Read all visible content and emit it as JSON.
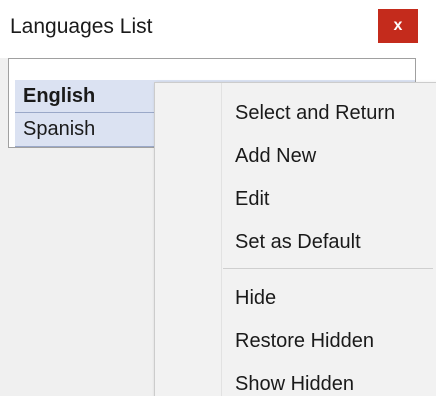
{
  "window": {
    "title": "Languages List",
    "close_label": "x"
  },
  "list": {
    "rows": [
      {
        "label": "English",
        "selected": true
      },
      {
        "label": "Spanish",
        "selected": false
      }
    ]
  },
  "context_menu": {
    "items": [
      {
        "label": "Select and Return"
      },
      {
        "label": "Add New"
      },
      {
        "label": "Edit"
      },
      {
        "label": "Set as Default"
      },
      {
        "label": "Hide"
      },
      {
        "label": "Restore Hidden"
      },
      {
        "label": "Show Hidden"
      }
    ]
  },
  "colors": {
    "close_button": "#c42b1c",
    "row_background": "#dbe2f2",
    "menu_background": "#f2f2f2"
  }
}
